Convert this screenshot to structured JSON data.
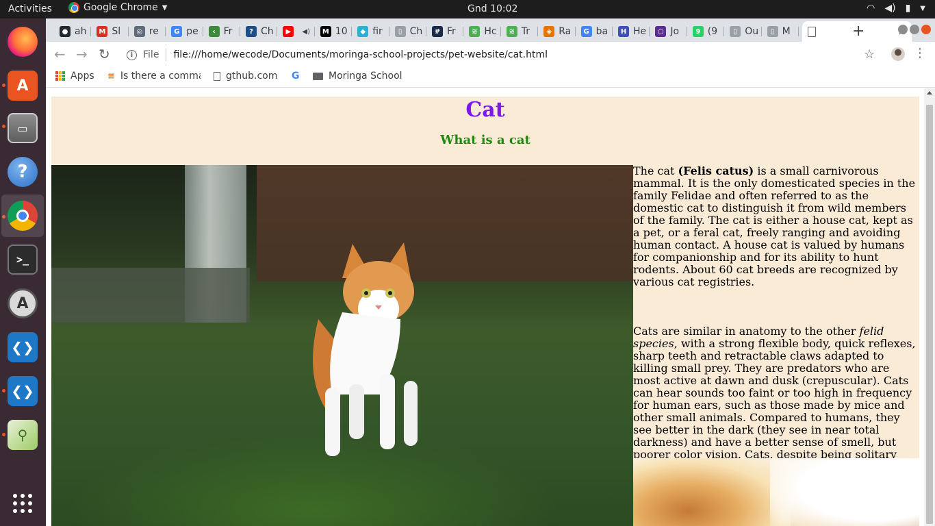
{
  "topbar": {
    "activities": "Activities",
    "app_name": "Google Chrome",
    "clock": "Gnd 10:02"
  },
  "dock": {
    "items": [
      {
        "name": "firefox",
        "icon": "firefox-icon"
      },
      {
        "name": "ubuntu-software",
        "icon": "software-center-icon"
      },
      {
        "name": "files",
        "icon": "file-cabinet-icon"
      },
      {
        "name": "help",
        "icon": "help-icon"
      },
      {
        "name": "chrome",
        "icon": "chrome-icon"
      },
      {
        "name": "terminal",
        "icon": "terminal-icon"
      },
      {
        "name": "software-updater",
        "icon": "updater-icon"
      },
      {
        "name": "vscode",
        "icon": "vscode-icon"
      },
      {
        "name": "vscode-2",
        "icon": "vscode-icon"
      },
      {
        "name": "image-viewer",
        "icon": "image-viewer-icon"
      },
      {
        "name": "show-applications",
        "icon": "app-grid-icon"
      }
    ]
  },
  "tabs": [
    {
      "label": "ah",
      "color": "#24292e",
      "glyph": "●"
    },
    {
      "label": "Sl",
      "color": "#d93025",
      "glyph": "M"
    },
    {
      "label": "re",
      "color": "#5f6b7a",
      "glyph": "◎"
    },
    {
      "label": "pe",
      "color": "#4285f4",
      "glyph": "G"
    },
    {
      "label": "Fr",
      "color": "#3c8a3c",
      "glyph": "‹"
    },
    {
      "label": "Ch",
      "color": "#1d4e89",
      "glyph": "?"
    },
    {
      "label": "",
      "color": "#ff0000",
      "glyph": "▶"
    },
    {
      "label": "10",
      "color": "#000000",
      "glyph": "M"
    },
    {
      "label": "fir",
      "color": "#2bb0d0",
      "glyph": "◆"
    },
    {
      "label": "Ch",
      "color": "#9aa0a6",
      "glyph": "▯"
    },
    {
      "label": "Fr",
      "color": "#1a2b4a",
      "glyph": "#"
    },
    {
      "label": "Hc",
      "color": "#4caf50",
      "glyph": "≋"
    },
    {
      "label": "Tr",
      "color": "#4caf50",
      "glyph": "≋"
    },
    {
      "label": "Ra",
      "color": "#e37400",
      "glyph": "◈"
    },
    {
      "label": "ba",
      "color": "#4285f4",
      "glyph": "G"
    },
    {
      "label": "He",
      "color": "#3f51b5",
      "glyph": "H"
    },
    {
      "label": "Jo",
      "color": "#5c2d91",
      "glyph": "○"
    },
    {
      "label": "(9",
      "color": "#25d366",
      "glyph": "9"
    },
    {
      "label": "Ou",
      "color": "#9aa0a6",
      "glyph": "▯"
    },
    {
      "label": "M",
      "color": "#9aa0a6",
      "glyph": "▯"
    }
  ],
  "active_tab": {
    "label": "",
    "close": "×"
  },
  "new_tab": "+",
  "address_bar": {
    "scheme_label": "File",
    "url": "file:///home/wecode/Documents/moringa-school-projects/pet-website/cat.html"
  },
  "bookmarks": [
    {
      "label": "Apps",
      "icon": "apps-grid-icon"
    },
    {
      "label": "Is there a comma",
      "icon": "stackoverflow-icon"
    },
    {
      "label": "gthub.com",
      "icon": "page-icon"
    },
    {
      "label": "",
      "icon": "google-icon"
    },
    {
      "label": "Moringa School",
      "icon": "folder-icon"
    }
  ],
  "page": {
    "title": "Cat",
    "subtitle": "What is a cat",
    "title_color": "#7d17f0",
    "subtitle_color": "#1e8a14",
    "background": "#faebd7",
    "para1_before": "The cat ",
    "para1_bold": "(Felis catus)",
    "para1_after": " is a small carnivorous mammal. It is the only domesticated species in the family Felidae and often referred to as the domestic cat to distinguish it from wild members of the family. The cat is either a house cat, kept as a pet, or a feral cat, freely ranging and avoiding human contact. A house cat is valued by humans for companionship and for its ability to hunt rodents. About 60 cat breeds are recognized by various cat registries.",
    "para2_before": "Cats are similar in anatomy to the other ",
    "para2_italic": "felid species",
    "para2_after": ", with a strong flexible body, quick reflexes, sharp teeth and retractable claws adapted to killing small prey. They are predators who are most active at dawn and dusk (crepuscular). Cats can hear sounds too faint or too high in frequency for human ears, such as those made by mice and other small animals. Compared to humans, they see better in the dark (they see in near total darkness) and have a better sense of smell, but poorer color vision. Cats, despite being solitary hunters, are a social species. Cat communication includes the use of vocalizations including mewing, purring, trilling, hissing, growling and grunting as well as cat-specific body language. Cats also communicate by secreting and perceiving pheromones."
  }
}
